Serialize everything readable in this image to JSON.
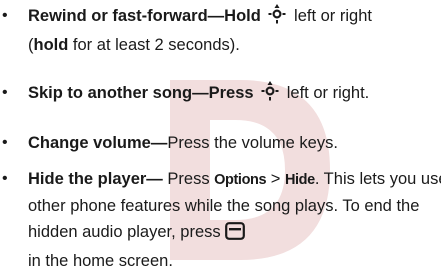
{
  "bullet_symbol": "•",
  "items": [
    {
      "title": "Rewind or fast-forward—Hold",
      "line1_rest": "left or right",
      "paren_open": "(",
      "bold_word": "hold",
      "line2_rest": "for at least 2 seconds)."
    },
    {
      "title": "Skip to another song—Press",
      "rest": "left or right."
    },
    {
      "title": "Change volume—",
      "rest": "Press the volume keys."
    },
    {
      "title": "Hide the player—",
      "press": "Press",
      "options_key": "Options",
      "sep": ">",
      "hide_key": "Hide",
      "after_keys": ". This lets you use other phone features while the song plays. To end the hidden audio player, press",
      "end_text": "in the home screen."
    }
  ],
  "icons": {
    "nav": "nav-key-icon",
    "menu": "menu-key-icon"
  },
  "colors": {
    "text": "#1a1a1a",
    "watermark": "#f2dede"
  }
}
